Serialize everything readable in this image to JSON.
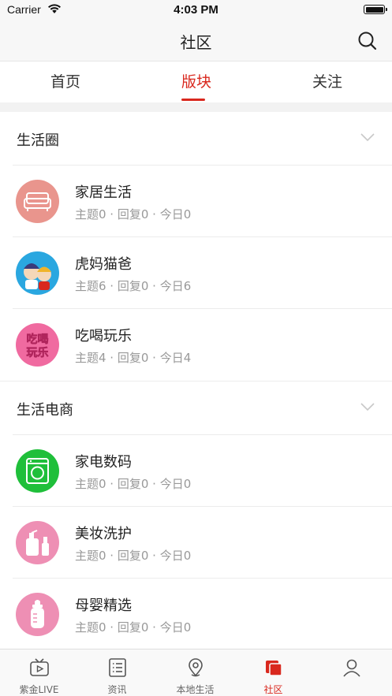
{
  "status_bar": {
    "carrier": "Carrier",
    "time": "4:03 PM"
  },
  "nav": {
    "title": "社区"
  },
  "tabs": [
    {
      "label": "首页",
      "active": false
    },
    {
      "label": "版块",
      "active": true
    },
    {
      "label": "关注",
      "active": false
    }
  ],
  "sections": [
    {
      "title": "生活圈",
      "forums": [
        {
          "name": "家居生活",
          "stats": "主题0 · 回复0 · 今日0",
          "icon": "sofa-icon"
        },
        {
          "name": "虎妈猫爸",
          "stats": "主题6 · 回复0 · 今日6",
          "icon": "parents-cartoon-icon"
        },
        {
          "name": "吃喝玩乐",
          "stats": "主题4 · 回复0 · 今日4",
          "icon": "eat-drink-play-icon",
          "icon_text": [
            "吃喝",
            "玩乐"
          ]
        }
      ]
    },
    {
      "title": "生活电商",
      "forums": [
        {
          "name": "家电数码",
          "stats": "主题0 · 回复0 · 今日0",
          "icon": "washing-machine-icon"
        },
        {
          "name": "美妆洗护",
          "stats": "主题0 · 回复0 · 今日0",
          "icon": "cosmetics-icon"
        },
        {
          "name": "母婴精选",
          "stats": "主题0 · 回复0 · 今日0",
          "icon": "baby-bottle-icon"
        }
      ]
    }
  ],
  "bottom_tabs": [
    {
      "label": "紫金LIVE",
      "icon": "tv-icon",
      "active": false
    },
    {
      "label": "资讯",
      "icon": "news-list-icon",
      "active": false
    },
    {
      "label": "本地生活",
      "icon": "location-pin-icon",
      "active": false
    },
    {
      "label": "社区",
      "icon": "community-icon",
      "active": true
    },
    {
      "label": "",
      "icon": "profile-icon",
      "active": false
    }
  ],
  "colors": {
    "accent": "#d9281e",
    "background": "#ffffff",
    "band": "#f2f2f2",
    "muted_text": "#999999"
  }
}
